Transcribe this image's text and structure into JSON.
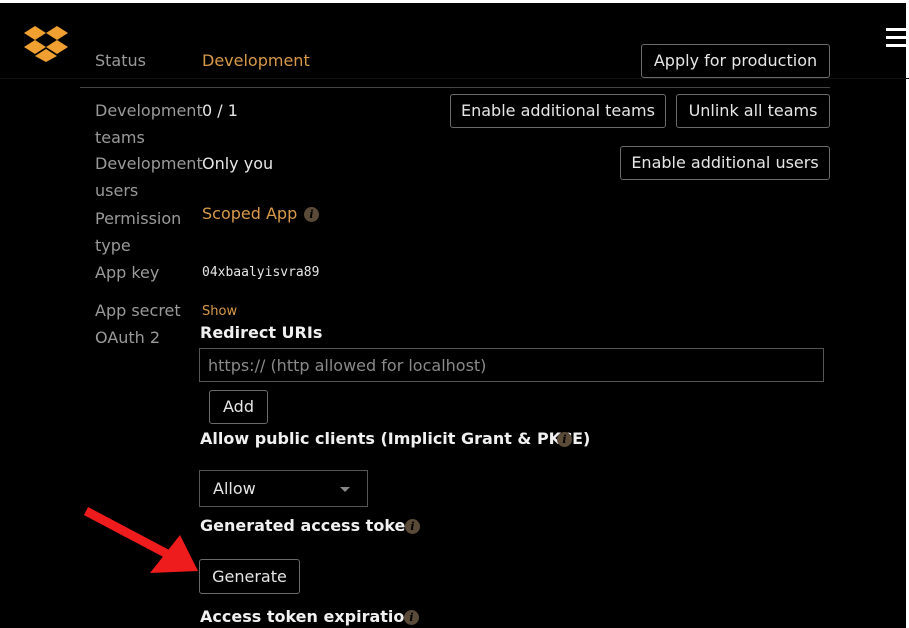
{
  "colors": {
    "accent_orange": "#d89a4a",
    "arrow_red": "#ee1c1c",
    "background": "#000000"
  },
  "header": {
    "logo_icon": "dropbox-logo-icon",
    "menu_icon": "hamburger-menu-icon"
  },
  "settings": {
    "status": {
      "label": "Status",
      "value": "Development",
      "button": "Apply for production"
    },
    "dev_teams": {
      "label_line1": "Development",
      "label_line2": "teams",
      "value": "0 / 1",
      "button_enable": "Enable additional teams",
      "button_unlink": "Unlink all teams"
    },
    "dev_users": {
      "label_line1": "Development",
      "label_line2": "users",
      "value": "Only you",
      "button": "Enable additional users"
    },
    "permission": {
      "label_line1": "Permission",
      "label_line2": "type",
      "value": "Scoped App"
    },
    "app_key": {
      "label": "App key",
      "value": "04xbaalyisvra89"
    },
    "app_secret": {
      "label": "App secret",
      "value": "Show"
    },
    "oauth": {
      "label": "OAuth 2",
      "redirect_title": "Redirect URIs",
      "redirect_placeholder": "https:// (http allowed for localhost)",
      "add_button": "Add",
      "public_clients_title": "Allow public clients (Implicit Grant & PKCE)",
      "public_clients_value": "Allow",
      "token_title": "Generated access token",
      "generate_button": "Generate",
      "expiration_title": "Access token expiration"
    }
  }
}
